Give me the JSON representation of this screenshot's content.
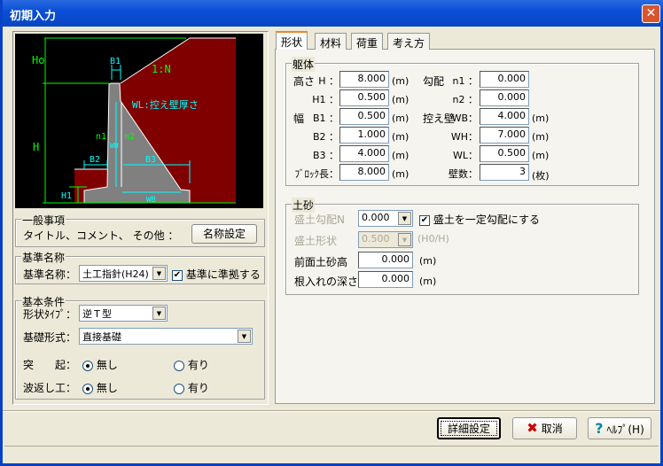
{
  "window": {
    "title": "初期入力",
    "close": "✕"
  },
  "diagram": {
    "labels": {
      "ho": "Ho",
      "h": "H",
      "b1": "B1",
      "b2": "B2",
      "b3": "B3",
      "h1": "H1",
      "n1": "n1",
      "n2": "n2",
      "wh": "WH",
      "wb": "WB",
      "slope": "1:N",
      "wl": "WL:控え壁厚さ"
    },
    "colors": {
      "soil": "#800000",
      "wall": "#808080",
      "dim": "#00ff00",
      "cyan": "#00ffff"
    }
  },
  "general": {
    "title": "一般事項",
    "text": "タイトル、コメント、 その他 ：",
    "button": "名称設定"
  },
  "standard": {
    "title": "基準名称",
    "label": "基準名称：",
    "value": "土工指針(H24)",
    "check_label": "基準に準拠する",
    "checked": true
  },
  "basic": {
    "title": "基本条件",
    "shape_label": "形状ﾀｲﾌﾟ：",
    "shape_value": "逆Ｔ型",
    "found_label": "基礎形式：",
    "found_value": "直接基礎",
    "prot_label": "突　　起：",
    "wave_label": "波返し工：",
    "none": "無し",
    "yes": "有り",
    "prot": "none",
    "wave": "none"
  },
  "tabs": [
    "形状",
    "材料",
    "荷重",
    "考え方"
  ],
  "body": {
    "title": "躯体",
    "height": "高さ",
    "width": "幅",
    "slope": "勾配",
    "buttress": "控え壁",
    "unit": "(m)",
    "count_unit": "(枚)",
    "H": {
      "label": "H ：",
      "value": "8.000"
    },
    "H1": {
      "label": "H1 ：",
      "value": "0.500"
    },
    "B1": {
      "label": "B1 ：",
      "value": "0.500"
    },
    "B2": {
      "label": "B2 ：",
      "value": "1.000"
    },
    "B3": {
      "label": "B3 ：",
      "value": "4.000"
    },
    "block": {
      "label": "ﾌﾞﾛｯｸ長：",
      "value": "8.000"
    },
    "n1": {
      "label": "n1 ：",
      "value": "0.000"
    },
    "n2": {
      "label": "n2 ：",
      "value": "0.000"
    },
    "WB": {
      "label": "WB：",
      "value": "4.000"
    },
    "WH": {
      "label": "WH：",
      "value": "7.000"
    },
    "WL": {
      "label": "WL：",
      "value": "0.500"
    },
    "walls": {
      "label": "壁数：",
      "value": "3"
    }
  },
  "soil": {
    "title": "土砂",
    "slope_label": "盛土勾配N",
    "slope_value": "0.000",
    "const_label": "盛土を一定勾配にする",
    "const_checked": true,
    "shape_label": "盛土形状",
    "shape_value": "0.500",
    "shape_unit": "(H0/H)",
    "front_label": "前面土砂高",
    "front_value": "0.000",
    "embed_label": "根入れの深さ",
    "embed_value": "0.000",
    "unit": "(m)"
  },
  "buttons": {
    "detail": "詳細設定",
    "cancel": "取消",
    "help": "ﾍﾙﾌﾟ(H)"
  }
}
